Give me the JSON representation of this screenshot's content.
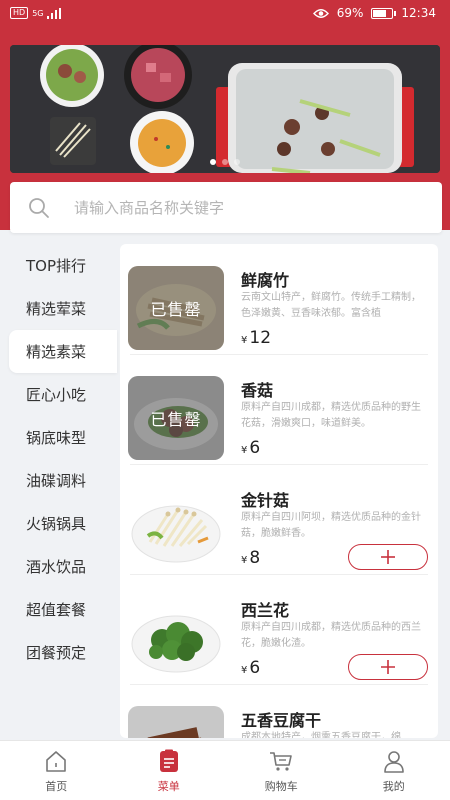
{
  "status_bar": {
    "network": "5G",
    "hd_label": "HD",
    "battery_percent": "69%",
    "battery_level": 0.69,
    "time": "12:34"
  },
  "banner": {
    "slide_count": 3,
    "active_index": 0
  },
  "search": {
    "placeholder": "请输入商品名称关键字"
  },
  "sidebar": {
    "items": [
      {
        "label": "TOP排行",
        "active": false
      },
      {
        "label": "精选荤菜",
        "active": false
      },
      {
        "label": "精选素菜",
        "active": true
      },
      {
        "label": "匠心小吃",
        "active": false
      },
      {
        "label": "锅底味型",
        "active": false
      },
      {
        "label": "油碟调料",
        "active": false
      },
      {
        "label": "火锅锅具",
        "active": false
      },
      {
        "label": "酒水饮品",
        "active": false
      },
      {
        "label": "超值套餐",
        "active": false
      },
      {
        "label": "团餐预定",
        "active": false
      }
    ]
  },
  "products": [
    {
      "name": "鲜腐竹",
      "desc": "云南文山特产，鲜腐竹。传统手工精制，色泽嫩黄、豆香味浓郁。富含植",
      "currency": "¥",
      "price": "12",
      "sold_out": true,
      "sold_out_label": "已售罄",
      "image": "yuba"
    },
    {
      "name": "香菇",
      "desc": "原料产自四川成都，精选优质品种的野生花菇，滑嫩爽口，味道鲜美。",
      "currency": "¥",
      "price": "6",
      "sold_out": true,
      "sold_out_label": "已售罄",
      "image": "mushroom"
    },
    {
      "name": "金针菇",
      "desc": "原料产自四川阿坝，精选优质品种的金针菇，脆嫩鲜香。",
      "currency": "¥",
      "price": "8",
      "sold_out": false,
      "add_icon": "plus-icon",
      "image": "enoki"
    },
    {
      "name": "西兰花",
      "desc": "原料产自四川成都，精选优质品种的西兰花，脆嫩化渣。",
      "currency": "¥",
      "price": "6",
      "sold_out": false,
      "add_icon": "plus-icon",
      "image": "broccoli"
    },
    {
      "name": "五香豆腐干",
      "desc": "成都本地特产，烟熏五香豆腐干，绵",
      "currency": "¥",
      "price": "",
      "sold_out": false,
      "image": "tofu"
    }
  ],
  "tabbar": {
    "items": [
      {
        "label": "首页",
        "icon": "home-icon",
        "active": false
      },
      {
        "label": "菜单",
        "icon": "menu-icon",
        "active": true
      },
      {
        "label": "购物车",
        "icon": "cart-icon",
        "active": false
      },
      {
        "label": "我的",
        "icon": "profile-icon",
        "active": false
      }
    ]
  },
  "colors": {
    "brand": "#c8313d",
    "background": "#f0f2f5",
    "text_muted": "#b0b0b0"
  }
}
